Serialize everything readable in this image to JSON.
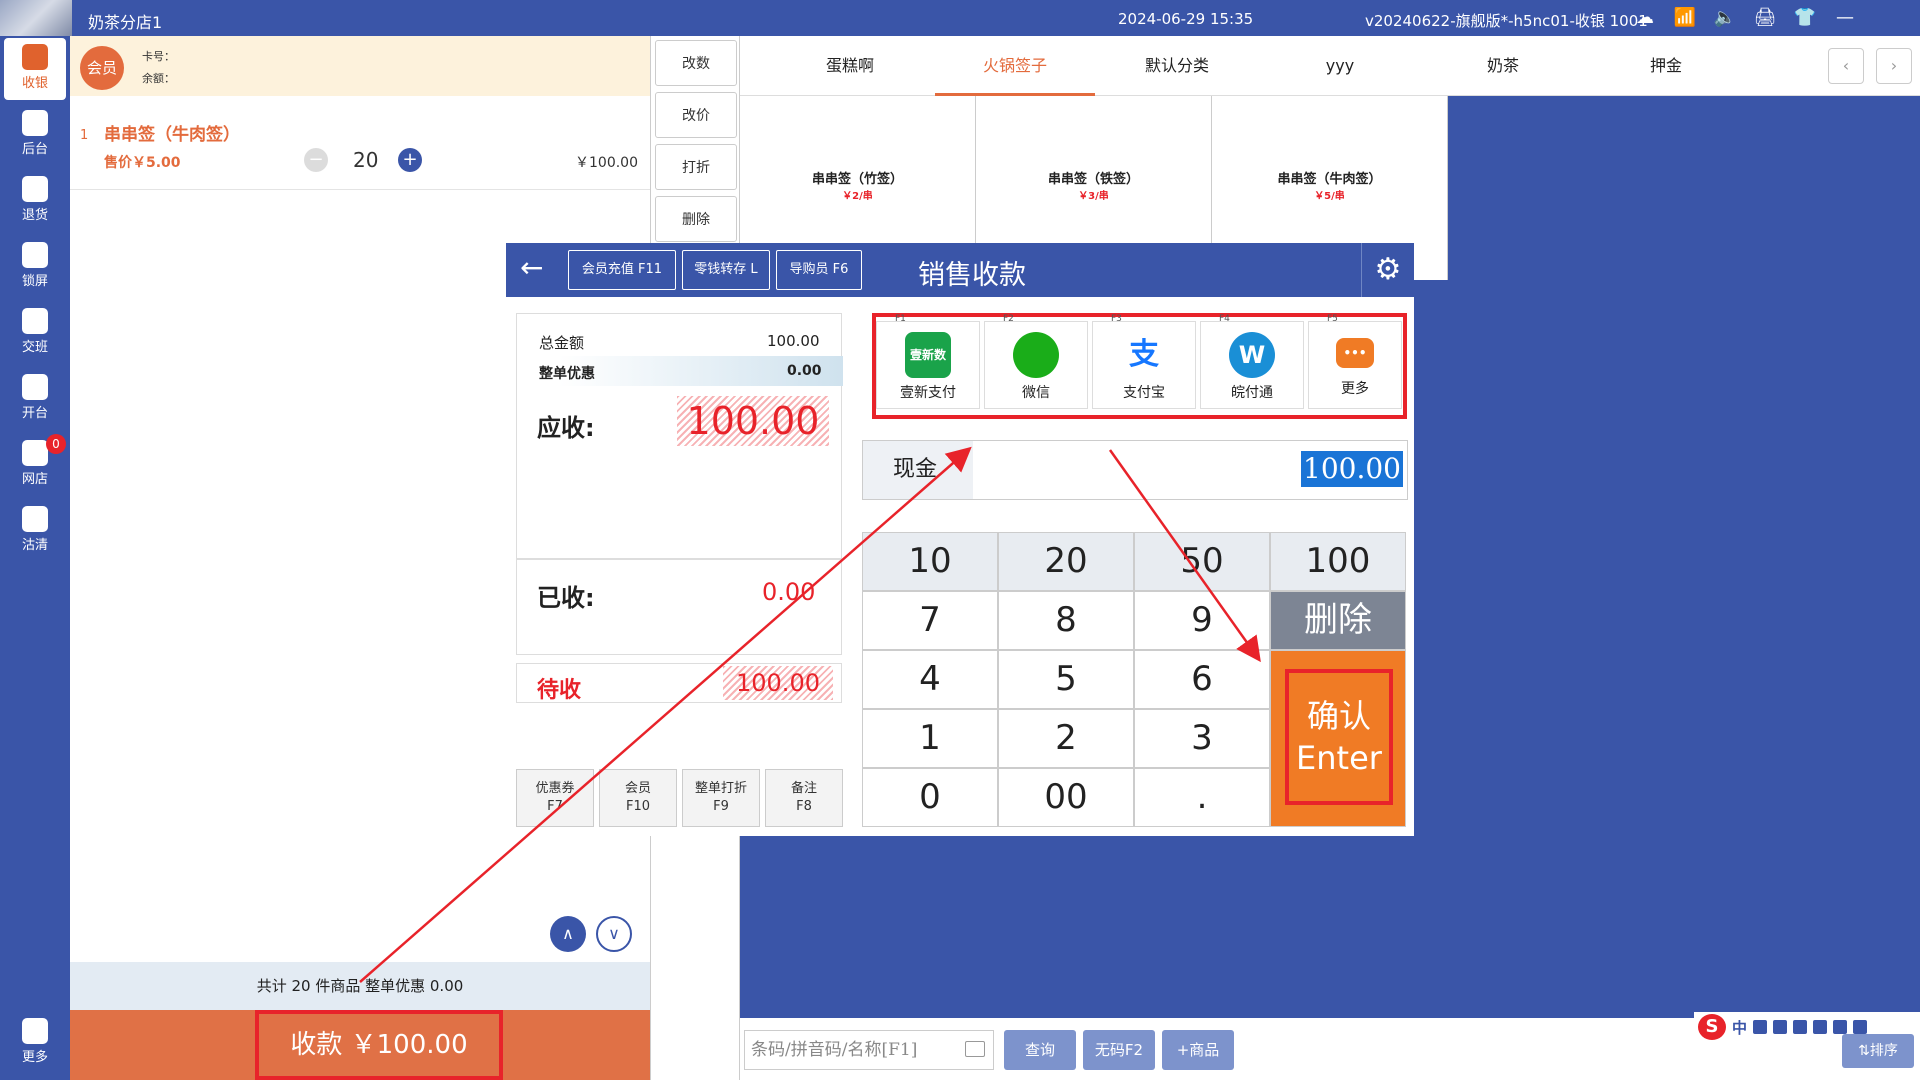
{
  "titlebar": {
    "store": "奶茶分店1",
    "datetime": "2024-06-29 15:35",
    "version": "v20240622-旗舰版*-h5nc01-收银 1001",
    "icons": [
      "cloud-icon",
      "wifi-icon",
      "mute-icon",
      "printer-icon",
      "shirt-icon",
      "minimize-icon"
    ]
  },
  "sidebar": {
    "items": [
      {
        "label": "收银",
        "icon": "cashier-icon"
      },
      {
        "label": "后台",
        "icon": "monitor-icon"
      },
      {
        "label": "退货",
        "icon": "return-icon"
      },
      {
        "label": "锁屏",
        "icon": "lock-icon"
      },
      {
        "label": "交班",
        "icon": "shift-icon"
      },
      {
        "label": "开台",
        "icon": "table-icon"
      },
      {
        "label": "网店",
        "icon": "store-icon",
        "badge": "0"
      },
      {
        "label": "沽清",
        "icon": "clear-icon"
      },
      {
        "label": "更多",
        "icon": "more-icon"
      }
    ]
  },
  "member": {
    "button": "会员",
    "card_label": "卡号：",
    "balance_label": "余额："
  },
  "order": {
    "item": {
      "index": "1",
      "name": "串串签（牛肉签）",
      "price": "售价￥5.00",
      "qty": "20",
      "total": "￥100.00"
    },
    "summary": "共计 20 件商品 整单优惠 0.00",
    "pay_button": "收款    ￥100.00"
  },
  "actions": [
    "改数",
    "改价",
    "打折",
    "删除"
  ],
  "categories": {
    "tabs": [
      "蛋糕啊",
      "火锅签子",
      "默认分类",
      "yyy",
      "奶茶",
      "押金"
    ],
    "active": "火锅签子"
  },
  "products": [
    {
      "name": "串串签（竹签）",
      "price": "￥2/串"
    },
    {
      "name": "串串签（铁签）",
      "price": "￥3/串"
    },
    {
      "name": "串串签（牛肉签）",
      "price": "￥5/串"
    }
  ],
  "search": {
    "placeholder": "条码/拼音码/名称[F1]",
    "query": "查询",
    "no_code": "无码F2",
    "add": "+商品",
    "sort": "⇅排序",
    "ime": "中"
  },
  "dialog": {
    "title": "销售收款",
    "head_buttons": [
      "会员充值 F11",
      "零钱转存 L",
      "导购员 F6"
    ],
    "total_label": "总金额",
    "total_value": "100.00",
    "discount_label": "整单优惠",
    "discount_value": "0.00",
    "due_label": "应收:",
    "due_value": "100.00",
    "paid_label": "已收:",
    "paid_value": "0.00",
    "pending_label": "待收",
    "pending_value": "100.00",
    "fn_buttons": [
      {
        "l1": "优惠券",
        "l2": "F7"
      },
      {
        "l1": "会员",
        "l2": "F10"
      },
      {
        "l1": "整单打折",
        "l2": "F9"
      },
      {
        "l1": "备注",
        "l2": "F8"
      }
    ],
    "pay_methods": [
      {
        "key": "F1",
        "label": "壹新支付",
        "icon": "yixin-pay-icon",
        "icon_text": "壹新数科",
        "color": "#1aa34a"
      },
      {
        "key": "F2",
        "label": "微信",
        "icon": "wechat-icon",
        "icon_text": "",
        "color": "#1aad19"
      },
      {
        "key": "F3",
        "label": "支付宝",
        "icon": "alipay-icon",
        "icon_text": "支",
        "color": "#1677ff"
      },
      {
        "key": "F4",
        "label": "皖付通",
        "icon": "wanfutong-icon",
        "icon_text": "W",
        "color": "#1a8fd6"
      },
      {
        "key": "F5",
        "label": "更多",
        "icon": "more-dots-icon",
        "icon_text": "•••",
        "color": "#f07b25"
      }
    ],
    "cash_label": "现金",
    "cash_value": "100.00",
    "keys": {
      "row1": [
        "10",
        "20",
        "50",
        "100"
      ],
      "row2": [
        "7",
        "8",
        "9",
        "删除"
      ],
      "row3": [
        "4",
        "5",
        "6"
      ],
      "row4": [
        "1",
        "2",
        "3"
      ],
      "row5": [
        "0",
        "00",
        "."
      ],
      "confirm_l1": "确认",
      "confirm_l2": "Enter"
    }
  },
  "colors": {
    "brand": "#3a55a8",
    "accent": "#e36b3d",
    "confirm": "#f07b25",
    "highlight": "#e8232a"
  }
}
